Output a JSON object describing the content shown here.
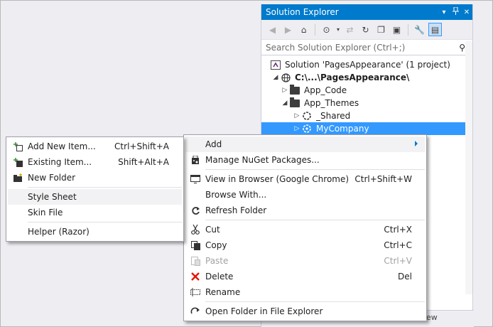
{
  "solution_explorer": {
    "title": "Solution Explorer",
    "title_buttons": {
      "dropdown": "▾",
      "pin": "📌",
      "close": "✕"
    },
    "search_placeholder": "Search Solution Explorer (Ctrl+;)",
    "tree": [
      {
        "label": "Solution 'PagesAppearance' (1 project)",
        "icon": "solution-icon"
      },
      {
        "label": "C:\\...\\PagesAppearance\\",
        "icon": "website-globe-icon"
      },
      {
        "label": "App_Code",
        "icon": "folder-icon"
      },
      {
        "label": "App_Themes",
        "icon": "folder-icon"
      },
      {
        "label": "_Shared",
        "icon": "theme-icon"
      },
      {
        "label": "MyCompany",
        "icon": "theme-icon",
        "selected": true
      }
    ],
    "bottom_tab_fragment": "ew"
  },
  "context_menu": {
    "items": [
      {
        "label": "Add",
        "shortcut": "",
        "icon": "",
        "submenu": true
      },
      {
        "label": "Manage NuGet Packages...",
        "shortcut": "",
        "icon": "nuget-icon"
      },
      {
        "label": "View in Browser (Google Chrome)",
        "shortcut": "Ctrl+Shift+W",
        "icon": "browser-icon"
      },
      {
        "label": "Browse With...",
        "shortcut": "",
        "icon": ""
      },
      {
        "label": "Refresh Folder",
        "shortcut": "",
        "icon": "refresh-icon"
      },
      {
        "label": "Cut",
        "shortcut": "Ctrl+X",
        "icon": "scissors-icon"
      },
      {
        "label": "Copy",
        "shortcut": "Ctrl+C",
        "icon": "copy-icon"
      },
      {
        "label": "Paste",
        "shortcut": "Ctrl+V",
        "icon": "paste-icon",
        "disabled": true
      },
      {
        "label": "Delete",
        "shortcut": "Del",
        "icon": "delete-x-icon"
      },
      {
        "label": "Rename",
        "shortcut": "",
        "icon": "rename-icon"
      },
      {
        "label": "Open Folder in File Explorer",
        "shortcut": "",
        "icon": "open-folder-icon"
      }
    ]
  },
  "add_submenu": {
    "items": [
      {
        "label": "Add New Item...",
        "shortcut": "Ctrl+Shift+A",
        "icon": "add-new-item-icon"
      },
      {
        "label": "Existing Item...",
        "shortcut": "Shift+Alt+A",
        "icon": "add-existing-item-icon"
      },
      {
        "label": "New Folder",
        "shortcut": "",
        "icon": "new-folder-icon"
      },
      {
        "label": "Style Sheet",
        "shortcut": "",
        "icon": ""
      },
      {
        "label": "Skin File",
        "shortcut": "",
        "icon": ""
      },
      {
        "label": "Helper (Razor)",
        "shortcut": "",
        "icon": ""
      }
    ]
  },
  "colors": {
    "accent": "#007acc",
    "selection": "#3399ff",
    "delete_red": "#e51400"
  }
}
